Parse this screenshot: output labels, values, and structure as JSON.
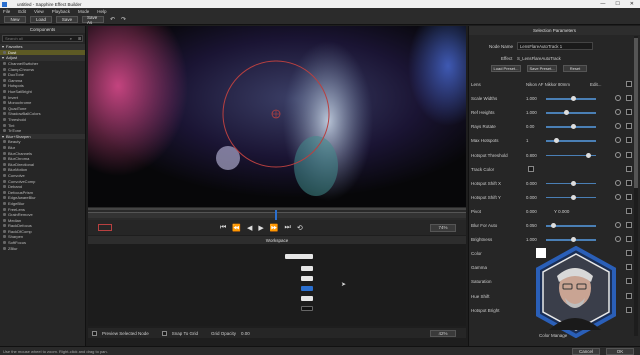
{
  "window": {
    "title": "untitled - Sapphire Effect Builder",
    "controls": [
      "—",
      "☐",
      "✕"
    ]
  },
  "menu": [
    "File",
    "Edit",
    "View",
    "Playback",
    "Mode",
    "Help"
  ],
  "toolbar": {
    "new": "New",
    "load": "Load",
    "save": "Save",
    "save_as": "Save As",
    "undo": "↶",
    "redo": "↷"
  },
  "components": {
    "title": "Components",
    "search_placeholder": "Search all",
    "groups": [
      {
        "name": "Favorites",
        "items": [
          "Dust"
        ]
      },
      {
        "name": "Adjust",
        "items": [
          "ChannelSwitcher",
          "ClampChroma",
          "DuoTone",
          "Gamma",
          "Hotspots",
          "HueSatBright",
          "Invert",
          "Monochrome",
          "QuadTone",
          "ShadowBallColors",
          "Threshold",
          "Tint",
          "TriTone"
        ]
      },
      {
        "name": "Blur+Sharpen",
        "items": [
          "Beauty",
          "Blur",
          "BlurChannels",
          "BlurChroma",
          "BlurDirectional",
          "BlurMotion",
          "Convolve",
          "ConvolveComp",
          "Deband",
          "DefocusPrism",
          "EdgeAwareBlur",
          "EdgeBlur",
          "FreeLens",
          "GrainRemove",
          "Median",
          "RackDefocus",
          "RackDfComp",
          "Sharpen",
          "SoftFocus",
          "ZBlur"
        ]
      }
    ]
  },
  "viewer": {
    "zoom": "74%",
    "hint": "Use the mouse wheel to zoom. Right-click and drag to pan."
  },
  "workspace": {
    "title": "Workspace",
    "preview_selected": "Preview Selected Node",
    "snap_to_grid": "Snap To Grid",
    "grid_opacity_label": "Grid Opacity",
    "grid_opacity_value": "0.00",
    "zoom": "42%"
  },
  "params": {
    "title": "Selection Parameters",
    "node_name_label": "Node Name",
    "node_name": "LensFlareAutoTrack 1",
    "effect_label": "Effect",
    "effect": "S_LensFlareAutoTrack",
    "load_preset": "Load Preset...",
    "save_preset": "Save Preset...",
    "reset": "Reset",
    "rows": [
      {
        "label": "Lens",
        "value": "Nikon AF Nikkor 80mm",
        "extra": "Edit...",
        "slider": null
      },
      {
        "label": "Scale Widths",
        "value": "1.000",
        "slider": 0.5
      },
      {
        "label": "Ref Heights",
        "value": "1.000",
        "slider": 0.35
      },
      {
        "label": "Rays Rotate",
        "value": "0.00",
        "slider": 0.5
      },
      {
        "label": "Max Hotspots",
        "value": "1",
        "slider": 0.15
      },
      {
        "label": "Hotspot Threshold",
        "value": "0.800",
        "slider": 0.8
      },
      {
        "label": "Track Color",
        "value": "",
        "slider": null
      },
      {
        "label": "Hotspot Shift X",
        "value": "0.000",
        "slider": 0.5
      },
      {
        "label": "Hotspot Shift Y",
        "value": "0.000",
        "slider": 0.5
      },
      {
        "label": "Pivot",
        "value": "0.000",
        "extra": "Y 0.000",
        "slider": null
      },
      {
        "label": "Blur For Auto",
        "value": "0.050",
        "slider": 0.1
      },
      {
        "label": "Brightness",
        "value": "1.000",
        "slider": 0.5
      },
      {
        "label": "Color",
        "value": "",
        "slider": null
      },
      {
        "label": "Gamma",
        "value": "",
        "slider": null
      },
      {
        "label": "Saturation",
        "value": "",
        "slider": null
      },
      {
        "label": "Hue Shift",
        "value": "",
        "slider": null
      },
      {
        "label": "Hotspot Bright",
        "value": "",
        "slider": null
      }
    ],
    "color_manager": "Color Manage"
  },
  "footer": {
    "cancel": "Cancel",
    "ok": "OK"
  },
  "colors": {
    "accent": "#2a6fcf",
    "selected": "#5d5a24",
    "flare_ring": "#b84040",
    "hex_frame": "#2a5fb8"
  }
}
